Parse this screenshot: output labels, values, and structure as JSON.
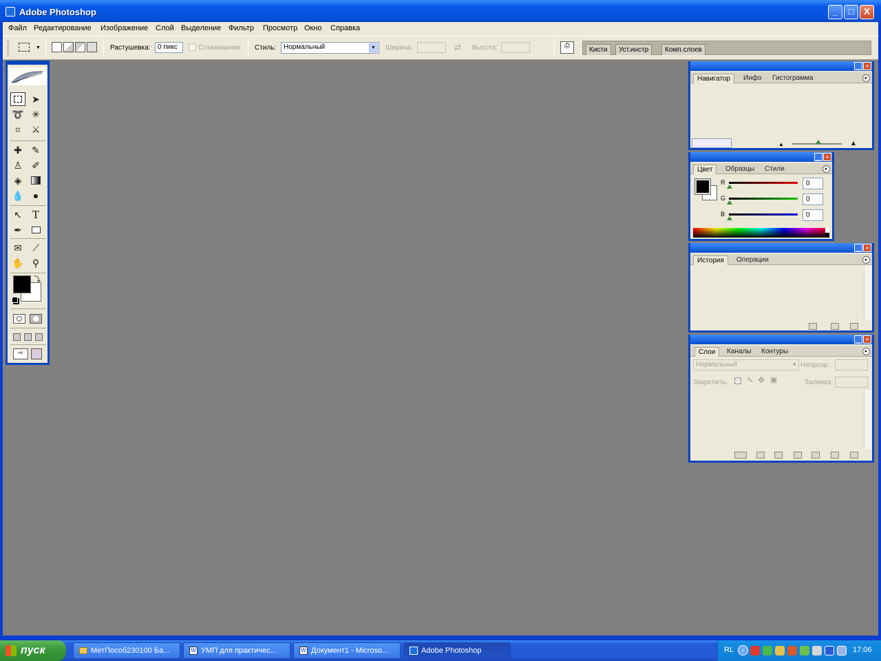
{
  "window": {
    "title": "Adobe Photoshop",
    "buttons": {
      "minimize": "_",
      "maximize": "□",
      "close": "X"
    }
  },
  "menu": [
    "Файл",
    "Редактирование",
    "Изображение",
    "Слой",
    "Выделение",
    "Фильтр",
    "Просмотр",
    "Окно",
    "Справка"
  ],
  "options": {
    "feather_label": "Растушевка:",
    "feather_value": "0 пикс",
    "antialias_label": "Сглаживание",
    "style_label": "Стиль:",
    "style_value": "Нормальный",
    "width_label": "Ширина:",
    "height_label": "Высота:",
    "well_tabs": [
      "Кисти",
      "Уст.инстр",
      "Комп.слоев"
    ]
  },
  "navigator_panel": {
    "tabs": [
      "Навигатор",
      "Инфо",
      "Гистограмма"
    ]
  },
  "color_panel": {
    "tabs": [
      "Цвет",
      "Образцы",
      "Стили"
    ],
    "channels": [
      {
        "label": "R",
        "value": "0",
        "color": "#e00000"
      },
      {
        "label": "G",
        "value": "0",
        "color": "#00c000"
      },
      {
        "label": "B",
        "value": "0",
        "color": "#0000e0"
      }
    ]
  },
  "history_panel": {
    "tabs": [
      "История",
      "Операции"
    ]
  },
  "layers_panel": {
    "tabs": [
      "Слои",
      "Каналы",
      "Контуры"
    ],
    "blend_mode": "Нормальный",
    "opacity_label": "Непрозр.:",
    "lock_label": "Закрепить:",
    "fill_label": "Заливка:"
  },
  "toolbox": {
    "foreground_color": "#000000",
    "background_color": "#ffffff"
  },
  "taskbar": {
    "start_label": "пуск",
    "buttons": [
      {
        "label": "МетПособ230100 Ба...",
        "icon": "folder-icon"
      },
      {
        "label": "УМП для практичес...",
        "icon": "word-icon"
      },
      {
        "label": "Документ1 - Microso...",
        "icon": "word-icon"
      },
      {
        "label": "Adobe Photoshop",
        "icon": "photoshop-icon"
      }
    ],
    "language": "RL",
    "clock": "17:06"
  },
  "colors": {
    "xp_blue": "#0a45c0",
    "panel_bg": "#ece9d8",
    "workspace": "#808080"
  }
}
